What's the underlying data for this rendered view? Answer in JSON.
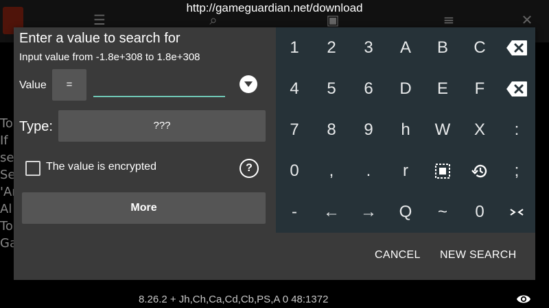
{
  "background": {
    "url": "http://gameguardian.net/download",
    "side_text": [
      "To",
      "If",
      "se",
      "Se",
      "'Ar",
      "Al",
      "To",
      "Ga"
    ],
    "status": "8.26.2  + Jh,Ch,Ca,Cd,Cb,PS,A  0  48:1372"
  },
  "dialog": {
    "title": "Enter a value to search for",
    "subtitle": "Input value from -1.8e+308 to 1.8e+308",
    "value_label": "Value",
    "operator": "=",
    "value_input": "",
    "type_label": "Type:",
    "type_value": "???",
    "encrypted_label": "The value is encrypted",
    "encrypted_checked": false,
    "more_label": "More",
    "cancel_label": "CANCEL",
    "new_search_label": "NEW SEARCH",
    "accent_color": "#6fc7b5",
    "keypad_color": "#263238"
  },
  "keypad": {
    "rows": [
      [
        {
          "label": "1"
        },
        {
          "label": "2"
        },
        {
          "label": "3"
        },
        {
          "label": "A"
        },
        {
          "label": "B"
        },
        {
          "label": "C"
        },
        {
          "label": "",
          "icon": "backspace-icon"
        }
      ],
      [
        {
          "label": "4"
        },
        {
          "label": "5"
        },
        {
          "label": "6"
        },
        {
          "label": "D"
        },
        {
          "label": "E"
        },
        {
          "label": "F"
        },
        {
          "label": "",
          "icon": "backspace-icon"
        }
      ],
      [
        {
          "label": "7"
        },
        {
          "label": "8"
        },
        {
          "label": "9"
        },
        {
          "label": "h"
        },
        {
          "label": "W"
        },
        {
          "label": "X"
        },
        {
          "label": ":"
        }
      ],
      [
        {
          "label": "0"
        },
        {
          "label": ","
        },
        {
          "label": "."
        },
        {
          "label": "r"
        },
        {
          "label": "",
          "icon": "select-all-icon"
        },
        {
          "label": "",
          "icon": "history-icon"
        },
        {
          "label": ";"
        }
      ],
      [
        {
          "label": "-"
        },
        {
          "label": "←"
        },
        {
          "label": "→"
        },
        {
          "label": "Q"
        },
        {
          "label": "~"
        },
        {
          "label": "0"
        },
        {
          "label": "",
          "icon": "collapse-icon"
        }
      ]
    ]
  }
}
